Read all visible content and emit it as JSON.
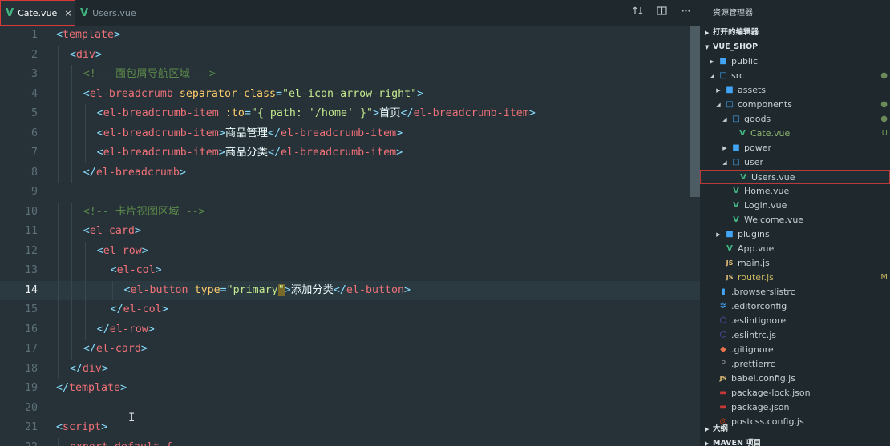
{
  "tabs": [
    {
      "label": "Cate.vue",
      "active": true,
      "close": "×"
    },
    {
      "label": "Users.vue",
      "active": false
    }
  ],
  "editor_actions": [
    "open-changes-icon",
    "split-editor-icon",
    "more-actions-icon"
  ],
  "code_lines": [
    {
      "n": "1",
      "indent": 0,
      "tokens": [
        {
          "c": "br",
          "t": "<"
        },
        {
          "c": "tg",
          "t": "template"
        },
        {
          "c": "br",
          "t": ">"
        }
      ]
    },
    {
      "n": "2",
      "indent": 1,
      "tokens": [
        {
          "c": "br",
          "t": "<"
        },
        {
          "c": "tg",
          "t": "div"
        },
        {
          "c": "br",
          "t": ">"
        }
      ]
    },
    {
      "n": "3",
      "indent": 2,
      "tokens": [
        {
          "c": "cm",
          "t": "<!-- 面包屑导航区域 -->"
        }
      ]
    },
    {
      "n": "4",
      "indent": 2,
      "tokens": [
        {
          "c": "br",
          "t": "<"
        },
        {
          "c": "tg",
          "t": "el-breadcrumb"
        },
        {
          "c": "tx",
          "t": " "
        },
        {
          "c": "at",
          "t": "separator-class"
        },
        {
          "c": "br",
          "t": "="
        },
        {
          "c": "st",
          "t": "\"el-icon-arrow-right\""
        },
        {
          "c": "br",
          "t": ">"
        }
      ]
    },
    {
      "n": "5",
      "indent": 3,
      "tokens": [
        {
          "c": "br",
          "t": "<"
        },
        {
          "c": "tg",
          "t": "el-breadcrumb-item"
        },
        {
          "c": "tx",
          "t": " "
        },
        {
          "c": "at",
          "t": ":to"
        },
        {
          "c": "br",
          "t": "="
        },
        {
          "c": "st",
          "t": "\"{ path: '/home' }\""
        },
        {
          "c": "br",
          "t": ">"
        },
        {
          "c": "tx",
          "t": "首页"
        },
        {
          "c": "br",
          "t": "</"
        },
        {
          "c": "tg",
          "t": "el-breadcrumb-item"
        },
        {
          "c": "br",
          "t": ">"
        }
      ]
    },
    {
      "n": "6",
      "indent": 3,
      "tokens": [
        {
          "c": "br",
          "t": "<"
        },
        {
          "c": "tg",
          "t": "el-breadcrumb-item"
        },
        {
          "c": "br",
          "t": ">"
        },
        {
          "c": "tx",
          "t": "商品管理"
        },
        {
          "c": "br",
          "t": "</"
        },
        {
          "c": "tg",
          "t": "el-breadcrumb-item"
        },
        {
          "c": "br",
          "t": ">"
        }
      ]
    },
    {
      "n": "7",
      "indent": 3,
      "tokens": [
        {
          "c": "br",
          "t": "<"
        },
        {
          "c": "tg",
          "t": "el-breadcrumb-item"
        },
        {
          "c": "br",
          "t": ">"
        },
        {
          "c": "tx",
          "t": "商品分类"
        },
        {
          "c": "br",
          "t": "</"
        },
        {
          "c": "tg",
          "t": "el-breadcrumb-item"
        },
        {
          "c": "br",
          "t": ">"
        }
      ]
    },
    {
      "n": "8",
      "indent": 2,
      "tokens": [
        {
          "c": "br",
          "t": "</"
        },
        {
          "c": "tg",
          "t": "el-breadcrumb"
        },
        {
          "c": "br",
          "t": ">"
        }
      ]
    },
    {
      "n": "9",
      "indent": 0,
      "tokens": []
    },
    {
      "n": "10",
      "indent": 2,
      "tokens": [
        {
          "c": "cm",
          "t": "<!-- 卡片视图区域 -->"
        }
      ]
    },
    {
      "n": "11",
      "indent": 2,
      "tokens": [
        {
          "c": "br",
          "t": "<"
        },
        {
          "c": "tg",
          "t": "el-card"
        },
        {
          "c": "br",
          "t": ">"
        }
      ]
    },
    {
      "n": "12",
      "indent": 3,
      "tokens": [
        {
          "c": "br",
          "t": "<"
        },
        {
          "c": "tg",
          "t": "el-row"
        },
        {
          "c": "br",
          "t": ">"
        }
      ]
    },
    {
      "n": "13",
      "indent": 4,
      "tokens": [
        {
          "c": "br",
          "t": "<"
        },
        {
          "c": "tg",
          "t": "el-col"
        },
        {
          "c": "br",
          "t": ">"
        }
      ]
    },
    {
      "n": "14",
      "indent": 5,
      "active": true,
      "tokens": [
        {
          "c": "br",
          "t": "<"
        },
        {
          "c": "tg",
          "t": "el-button"
        },
        {
          "c": "tx",
          "t": " "
        },
        {
          "c": "at",
          "t": "type"
        },
        {
          "c": "br",
          "t": "="
        },
        {
          "c": "st",
          "t": "\"primary"
        },
        {
          "c": "cur",
          "t": "\""
        },
        {
          "c": "br",
          "t": ">"
        },
        {
          "c": "tx",
          "t": "添加分类"
        },
        {
          "c": "br",
          "t": "</"
        },
        {
          "c": "tg",
          "t": "el-button"
        },
        {
          "c": "br",
          "t": ">"
        }
      ]
    },
    {
      "n": "15",
      "indent": 4,
      "tokens": [
        {
          "c": "br",
          "t": "</"
        },
        {
          "c": "tg",
          "t": "el-col"
        },
        {
          "c": "br",
          "t": ">"
        }
      ]
    },
    {
      "n": "16",
      "indent": 3,
      "tokens": [
        {
          "c": "br",
          "t": "</"
        },
        {
          "c": "tg",
          "t": "el-row"
        },
        {
          "c": "br",
          "t": ">"
        }
      ]
    },
    {
      "n": "17",
      "indent": 2,
      "tokens": [
        {
          "c": "br",
          "t": "</"
        },
        {
          "c": "tg",
          "t": "el-card"
        },
        {
          "c": "br",
          "t": ">"
        }
      ]
    },
    {
      "n": "18",
      "indent": 1,
      "tokens": [
        {
          "c": "br",
          "t": "</"
        },
        {
          "c": "tg",
          "t": "div"
        },
        {
          "c": "br",
          "t": ">"
        }
      ]
    },
    {
      "n": "19",
      "indent": 0,
      "tokens": [
        {
          "c": "br",
          "t": "</"
        },
        {
          "c": "tg",
          "t": "template"
        },
        {
          "c": "br",
          "t": ">"
        }
      ]
    },
    {
      "n": "20",
      "indent": 0,
      "tokens": []
    },
    {
      "n": "21",
      "indent": 0,
      "tokens": [
        {
          "c": "br",
          "t": "<"
        },
        {
          "c": "tg",
          "t": "script"
        },
        {
          "c": "br",
          "t": ">"
        }
      ]
    },
    {
      "n": "22",
      "indent": 1,
      "tokens": [
        {
          "c": "tg",
          "t": "export default {"
        }
      ]
    }
  ],
  "explorer": {
    "title": "资源管理器",
    "open_editors": "打开的编辑器",
    "project": "VUE_SHOP",
    "items": [
      {
        "name": "public",
        "depth": 1,
        "type": "folder",
        "arrow": "right",
        "mark": ""
      },
      {
        "name": "src",
        "depth": 1,
        "type": "folder-open",
        "arrow": "down",
        "mark": "●"
      },
      {
        "name": "assets",
        "depth": 2,
        "type": "folder",
        "arrow": "right",
        "mark": ""
      },
      {
        "name": "components",
        "depth": 2,
        "type": "folder-open",
        "arrow": "down",
        "mark": "●"
      },
      {
        "name": "goods",
        "depth": 3,
        "type": "folder-open",
        "arrow": "down",
        "mark": "●"
      },
      {
        "name": "Cate.vue",
        "depth": 4,
        "type": "vue",
        "arrow": "",
        "mark": "U"
      },
      {
        "name": "power",
        "depth": 3,
        "type": "folder",
        "arrow": "right",
        "mark": ""
      },
      {
        "name": "user",
        "depth": 3,
        "type": "folder-open",
        "arrow": "down",
        "mark": ""
      },
      {
        "name": "Users.vue",
        "depth": 4,
        "type": "vue",
        "arrow": "",
        "mark": "",
        "selected": true
      },
      {
        "name": "Home.vue",
        "depth": 3,
        "type": "vue",
        "arrow": "",
        "mark": ""
      },
      {
        "name": "Login.vue",
        "depth": 3,
        "type": "vue",
        "arrow": "",
        "mark": ""
      },
      {
        "name": "Welcome.vue",
        "depth": 3,
        "type": "vue",
        "arrow": "",
        "mark": ""
      },
      {
        "name": "plugins",
        "depth": 2,
        "type": "folder",
        "arrow": "right",
        "mark": ""
      },
      {
        "name": "App.vue",
        "depth": 2,
        "type": "vue",
        "arrow": "",
        "mark": ""
      },
      {
        "name": "main.js",
        "depth": 2,
        "type": "js",
        "arrow": "",
        "mark": ""
      },
      {
        "name": "router.js",
        "depth": 2,
        "type": "js",
        "arrow": "",
        "mark": "M"
      },
      {
        "name": ".browserslistrc",
        "depth": 1,
        "type": "file-doc",
        "arrow": "",
        "mark": ""
      },
      {
        "name": ".editorconfig",
        "depth": 1,
        "type": "gear",
        "arrow": "",
        "mark": ""
      },
      {
        "name": ".eslintignore",
        "depth": 1,
        "type": "eslint",
        "arrow": "",
        "mark": ""
      },
      {
        "name": ".eslintrc.js",
        "depth": 1,
        "type": "eslint",
        "arrow": "",
        "mark": ""
      },
      {
        "name": ".gitignore",
        "depth": 1,
        "type": "git",
        "arrow": "",
        "mark": ""
      },
      {
        "name": ".prettierrc",
        "depth": 1,
        "type": "prettier",
        "arrow": "",
        "mark": ""
      },
      {
        "name": "babel.config.js",
        "depth": 1,
        "type": "js",
        "arrow": "",
        "mark": ""
      },
      {
        "name": "package-lock.json",
        "depth": 1,
        "type": "npm",
        "arrow": "",
        "mark": ""
      },
      {
        "name": "package.json",
        "depth": 1,
        "type": "npm",
        "arrow": "",
        "mark": ""
      },
      {
        "name": "postcss.config.js",
        "depth": 1,
        "type": "postcss",
        "arrow": "",
        "mark": ""
      }
    ],
    "outline": "大纲",
    "maven": "MAVEN 项目"
  }
}
